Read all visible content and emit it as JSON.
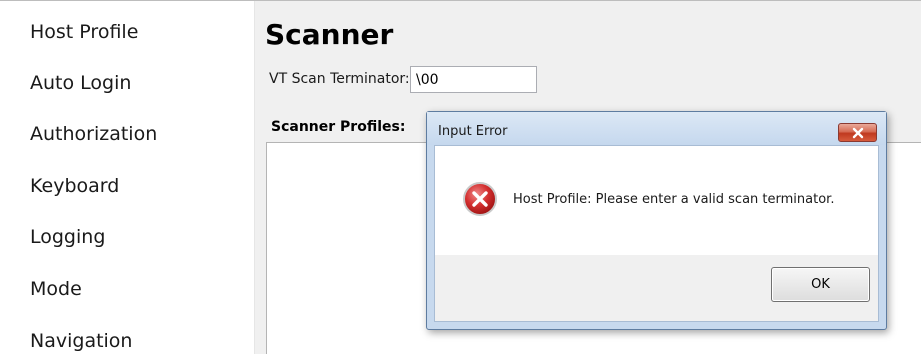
{
  "sidebar": {
    "items": [
      {
        "label": "Host Profile"
      },
      {
        "label": "Auto Login"
      },
      {
        "label": "Authorization"
      },
      {
        "label": "Keyboard"
      },
      {
        "label": "Logging"
      },
      {
        "label": "Mode"
      },
      {
        "label": "Navigation"
      }
    ]
  },
  "main": {
    "title": "Scanner",
    "terminator_label": "VT Scan Terminator:",
    "terminator_value": "\\00",
    "profiles_label": "Scanner Profiles:"
  },
  "dialog": {
    "title": "Input Error",
    "message": "Host Profile: Please enter a valid scan terminator.",
    "ok_label": "OK",
    "icon": "error-icon",
    "close_icon": "close-icon"
  },
  "colors": {
    "error_red": "#d32f2f",
    "close_button_red": "#c7482b",
    "dialog_frame": "#c7d9ee"
  }
}
